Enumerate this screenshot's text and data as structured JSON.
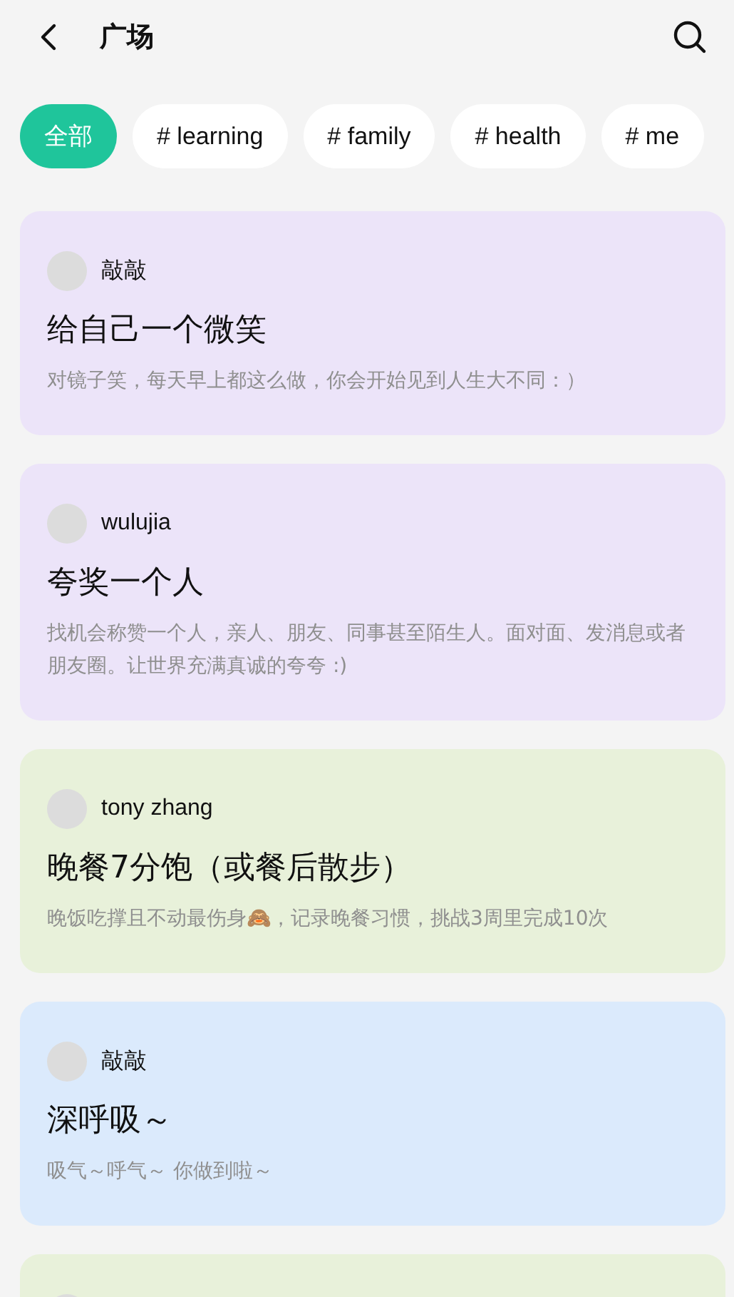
{
  "header": {
    "title": "广场"
  },
  "tags": [
    {
      "label": "全部",
      "selected": true
    },
    {
      "label": "# learning",
      "selected": false
    },
    {
      "label": "# family",
      "selected": false
    },
    {
      "label": "# health",
      "selected": false
    },
    {
      "label": "# me",
      "selected": false
    }
  ],
  "posts": [
    {
      "author": "敲敲",
      "title": "给自己一个微笑",
      "description": "对镜子笑，每天早上都这么做，你会开始见到人生大不同：）",
      "color": "#ece4f9"
    },
    {
      "author": "wulujia",
      "title": "夸奖一个人",
      "description": "找机会称赞一个人，亲人、朋友、同事甚至陌生人。面对面、发消息或者朋友圈。让世界充满真诚的夸夸 :)",
      "color": "#ece4f9"
    },
    {
      "author": "tony zhang",
      "title": "晚餐7分饱（或餐后散步）",
      "description": "晚饭吃撑且不动最伤身🙈，记录晚餐习惯，挑战3周里完成10次",
      "color": "#e8f1da"
    },
    {
      "author": "敲敲",
      "title": "深呼吸～",
      "description": "吸气～呼气～ 你做到啦～",
      "color": "#dbeafc"
    },
    {
      "color": "#e8f1da"
    }
  ]
}
